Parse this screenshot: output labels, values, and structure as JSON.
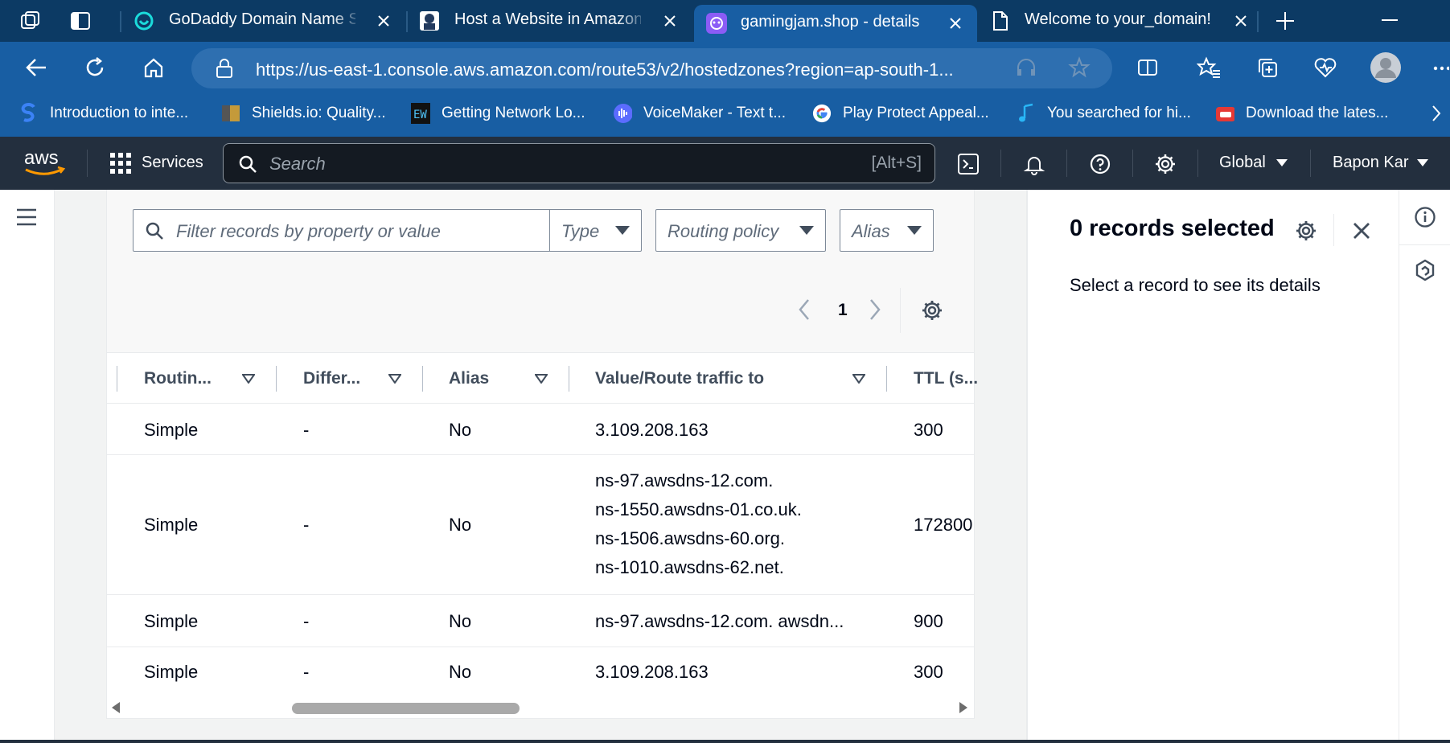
{
  "browser": {
    "tabs": [
      {
        "title": "GoDaddy Domain Name Sea",
        "icon": "godaddy-icon",
        "active": false
      },
      {
        "title": "Host a Website in Amazon W",
        "icon": "robot-avatar-icon",
        "active": false
      },
      {
        "title": "gamingjam.shop - details",
        "icon": "purple-app-icon",
        "active": true
      },
      {
        "title": "Welcome to your_domain!",
        "icon": "page-icon",
        "active": false
      }
    ],
    "url": "https://us-east-1.console.aws.amazon.com/route53/v2/hostedzones?region=ap-south-1...",
    "bookmarks": [
      {
        "label": "Introduction to inte...",
        "icon": "s-logo-icon",
        "color": "#3b82f6"
      },
      {
        "label": "Shields.io: Quality...",
        "icon": "shields-icon",
        "color": "#c49a3a"
      },
      {
        "label": "Getting Network Lo...",
        "icon": "ew-logo-icon",
        "color": "#1a6fb3"
      },
      {
        "label": "VoiceMaker - Text t...",
        "icon": "voicemaker-icon",
        "color": "#6b5cff"
      },
      {
        "label": "Play Protect Appeal...",
        "icon": "google-icon",
        "color": "#ffffff"
      },
      {
        "label": "You searched for hi...",
        "icon": "music-note-icon",
        "color": "#29b6f6"
      },
      {
        "label": "Download the lates...",
        "icon": "gamepad-icon",
        "color": "#e53935"
      }
    ]
  },
  "aws_header": {
    "logo": "aws",
    "services_label": "Services",
    "search_placeholder": "Search",
    "search_shortcut": "[Alt+S]",
    "region": "Global",
    "user": "Bapon Kar"
  },
  "filters": {
    "search_placeholder": "Filter records by property or value",
    "type_label": "Type",
    "routing_label": "Routing policy",
    "alias_label": "Alias"
  },
  "pagination": {
    "page": "1"
  },
  "table": {
    "columns": [
      "Routin...",
      "Differ...",
      "Alias",
      "Value/Route traffic to",
      "TTL (s..."
    ],
    "rows": [
      {
        "routing": "Simple",
        "differ": "-",
        "alias": "No",
        "value": [
          "3.109.208.163"
        ],
        "ttl": "300"
      },
      {
        "routing": "Simple",
        "differ": "-",
        "alias": "No",
        "value": [
          "ns-97.awsdns-12.com.",
          "ns-1550.awsdns-01.co.uk.",
          "ns-1506.awsdns-60.org.",
          "ns-1010.awsdns-62.net."
        ],
        "ttl": "172800"
      },
      {
        "routing": "Simple",
        "differ": "-",
        "alias": "No",
        "value": [
          "ns-97.awsdns-12.com. awsdn..."
        ],
        "ttl": "900"
      },
      {
        "routing": "Simple",
        "differ": "-",
        "alias": "No",
        "value": [
          "3.109.208.163"
        ],
        "ttl": "300"
      }
    ]
  },
  "split_panel": {
    "title": "0 records selected",
    "message": "Select a record to see its details"
  },
  "colors": {
    "tabstrip": "#0c3a64",
    "browser_chrome": "#185ea3",
    "aws_header": "#232f3e",
    "aws_orange": "#ff9900"
  }
}
